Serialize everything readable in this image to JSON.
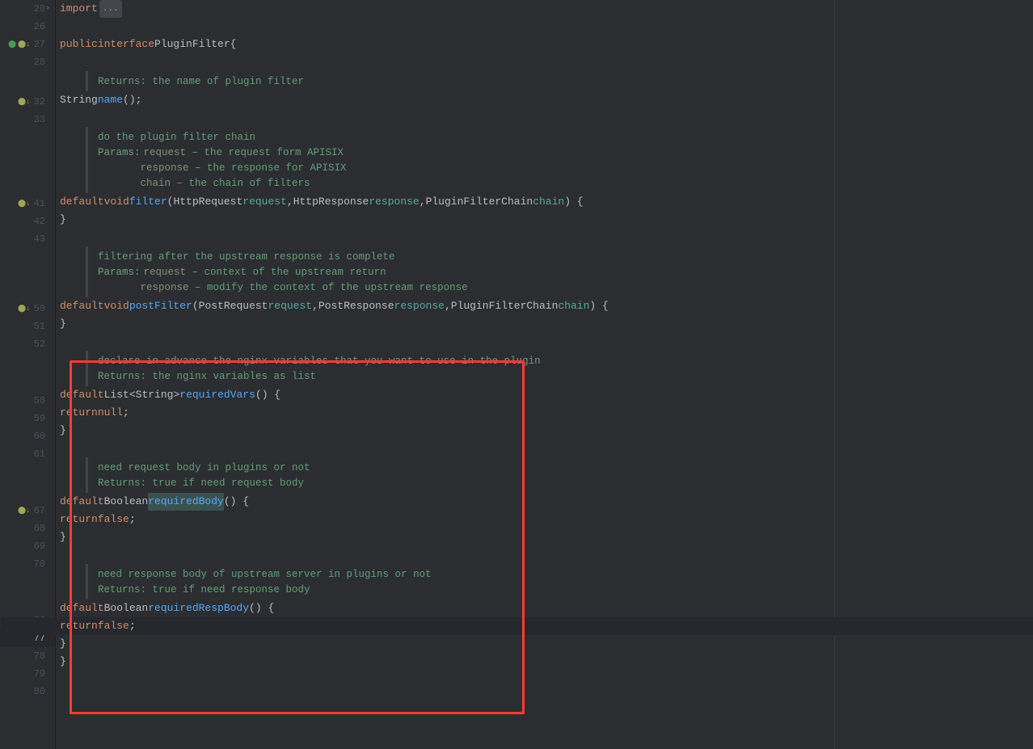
{
  "lines": {
    "20": "20",
    "26": "26",
    "27": "27",
    "28": "28",
    "32": "32",
    "33": "33",
    "41": "41",
    "42": "42",
    "43": "43",
    "50": "50",
    "51": "51",
    "52": "52",
    "58": "58",
    "59": "59",
    "60": "60",
    "61": "61",
    "67": "67",
    "68": "68",
    "69": "69",
    "70": "70",
    "76": "76",
    "77": "77",
    "78": "78",
    "79": "79",
    "80": "80"
  },
  "kw": {
    "import": "import",
    "public": "public",
    "interface": "interface",
    "default": "default",
    "void": "void",
    "return": "return",
    "null": "null",
    "false": "false"
  },
  "types": {
    "String": "String",
    "HttpRequest": "HttpRequest",
    "HttpResponse": "HttpResponse",
    "PluginFilterChain": "PluginFilterChain",
    "PostRequest": "PostRequest",
    "PostResponse": "PostResponse",
    "List": "List",
    "Boolean": "Boolean",
    "PluginFilter": "PluginFilter"
  },
  "methods": {
    "name": "name",
    "filter": "filter",
    "postFilter": "postFilter",
    "requiredVars": "requiredVars",
    "requiredBody": "requiredBody",
    "requiredRespBody": "requiredRespBody"
  },
  "vars": {
    "request": "request",
    "response": "response",
    "chain": "chain"
  },
  "punct": {
    "fold": "...",
    "obrace": "{",
    "cbrace": "}",
    "parens": "();",
    "oparen": "(",
    "cparen": ")",
    "comma": ",",
    "semi": ";",
    "lt": "<",
    "gt": ">",
    "ocb": ") {",
    "cc": ") {"
  },
  "doc": {
    "returnsName": "Returns: the name of plugin filter",
    "doChain": "do the plugin filter chain",
    "paramsLabel": "Params:",
    "p_request": " – the request form APISIX",
    "p_response": " – the response for APISIX",
    "p_chain": " – the chain of filters",
    "afterUpstream": "filtering after the upstream response is complete",
    "p_request2": " – context of the upstream return",
    "p_response2": " – modify the context of the upstream response",
    "declareNginx": "declare in advance the nginx variables that you want to use in the plugin",
    "returnsNginx": "Returns: the nginx variables as list",
    "needReqBody": "need request body in plugins or not",
    "returnsReqBody": "Returns: true if need request body",
    "needRespBody": "need response body of upstream server in plugins or not",
    "returnsRespBody": "Returns: true if need response body"
  }
}
